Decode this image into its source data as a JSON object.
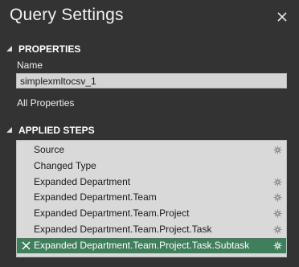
{
  "panel": {
    "title": "Query Settings"
  },
  "properties": {
    "header": "PROPERTIES",
    "name_label": "Name",
    "name_value": "simplexmltocsv_1",
    "all_properties_link": "All Properties"
  },
  "applied_steps": {
    "header": "APPLIED STEPS",
    "items": [
      {
        "label": "Source",
        "has_gear": true,
        "selected": false
      },
      {
        "label": "Changed Type",
        "has_gear": false,
        "selected": false
      },
      {
        "label": "Expanded Department",
        "has_gear": true,
        "selected": false
      },
      {
        "label": "Expanded Department.Team",
        "has_gear": true,
        "selected": false
      },
      {
        "label": "Expanded Department.Team.Project",
        "has_gear": true,
        "selected": false
      },
      {
        "label": "Expanded Department.Team.Project.Task",
        "has_gear": true,
        "selected": false
      },
      {
        "label": "Expanded Department.Team.Project.Task.Subtask",
        "has_gear": true,
        "selected": true
      }
    ]
  },
  "icons": {
    "close": "close-icon",
    "collapse": "collapse-triangle-icon",
    "gear": "gear-icon",
    "delete": "delete-x-icon"
  },
  "colors": {
    "background": "#333333",
    "selected_step": "#3f7f5c",
    "input_background": "#d4d4d4"
  }
}
